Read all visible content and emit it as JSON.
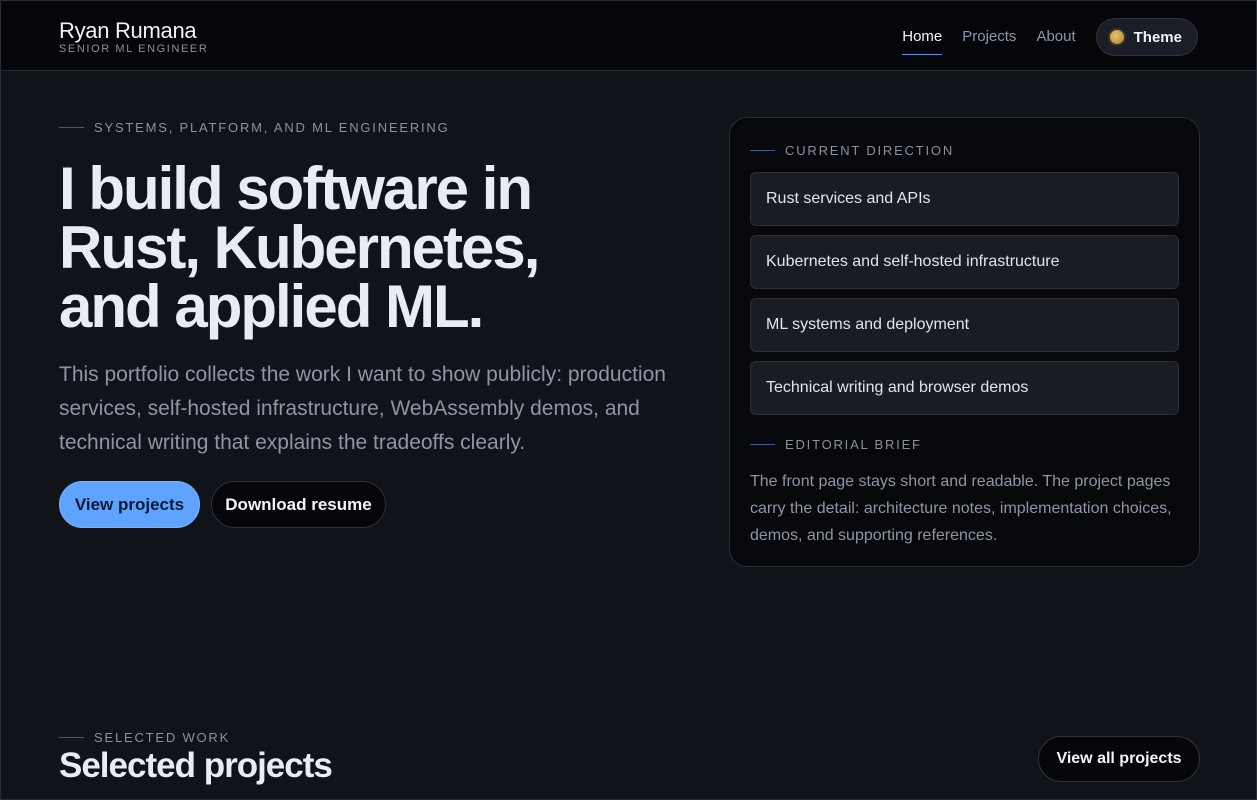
{
  "brand": {
    "name": "Ryan Rumana",
    "role": "SENIOR ML ENGINEER"
  },
  "nav": {
    "items": [
      {
        "label": "Home",
        "active": true
      },
      {
        "label": "Projects",
        "active": false
      },
      {
        "label": "About",
        "active": false
      }
    ],
    "theme_label": "Theme"
  },
  "hero": {
    "eyebrow": "SYSTEMS, PLATFORM, AND ML ENGINEERING",
    "title_lines": [
      "I build software in",
      "Rust, Kubernetes,",
      "and applied ML."
    ],
    "description": "This portfolio collects the work I want to show publicly: production services, self-hosted infrastructure, WebAssembly demos, and technical writing that explains the tradeoffs clearly.",
    "primary_cta": "View projects",
    "secondary_cta": "Download resume"
  },
  "panel": {
    "direction_label": "CURRENT DIRECTION",
    "directions": [
      "Rust services and APIs",
      "Kubernetes and self-hosted infrastructure",
      "ML systems and deployment",
      "Technical writing and browser demos"
    ],
    "brief_label": "EDITORIAL BRIEF",
    "brief_text": "The front page stays short and readable. The project pages carry the detail: architecture notes, implementation choices, demos, and supporting references."
  },
  "work": {
    "eyebrow": "SELECTED WORK",
    "title": "Selected projects",
    "view_all": "View all projects"
  },
  "colors": {
    "background": "#11131b",
    "header": "#05060a",
    "accent": "#5ea3ff",
    "theme_dot": "#d4b25a"
  }
}
